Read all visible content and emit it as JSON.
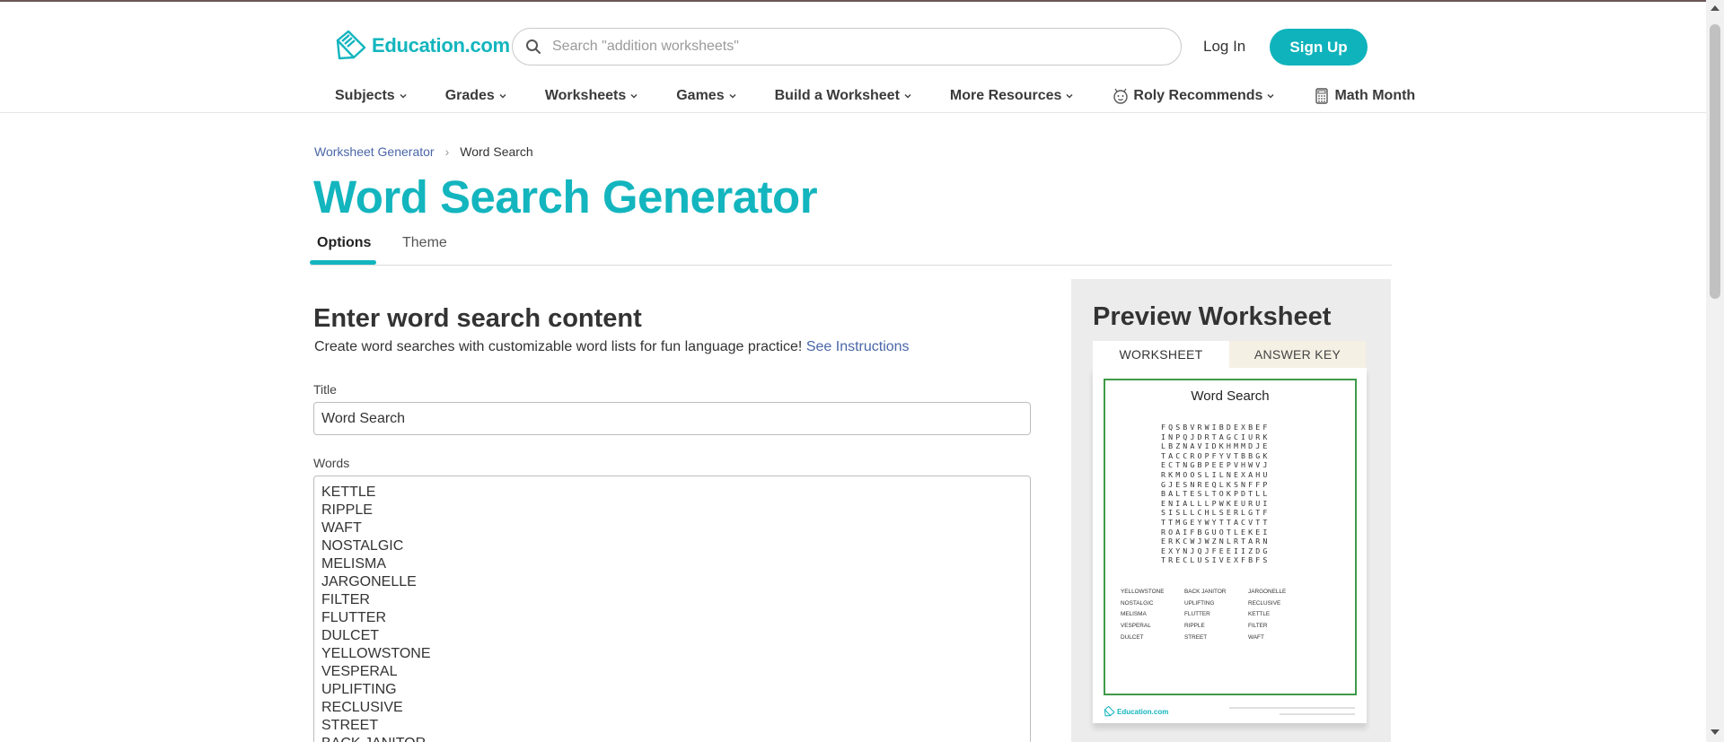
{
  "header": {
    "logo_text": "Education.com",
    "search_placeholder": "Search \"addition worksheets\"",
    "login_label": "Log In",
    "signup_label": "Sign Up",
    "brand_color": "#13b5be"
  },
  "nav": {
    "items": [
      {
        "label": "Subjects"
      },
      {
        "label": "Grades"
      },
      {
        "label": "Worksheets"
      },
      {
        "label": "Games"
      },
      {
        "label": "Build a Worksheet"
      },
      {
        "label": "More Resources"
      },
      {
        "label": "Roly Recommends",
        "icon": "roly-icon"
      },
      {
        "label": "Math Month",
        "icon": "calculator-icon"
      }
    ]
  },
  "breadcrumb": {
    "parent": "Worksheet Generator",
    "current": "Word Search"
  },
  "page": {
    "title": "Word Search Generator"
  },
  "tabs": {
    "options": "Options",
    "theme": "Theme",
    "active": "Options"
  },
  "form": {
    "section_title": "Enter word search content",
    "description": "Create word searches with customizable word lists for fun language practice!",
    "instructions_link": "See Instructions",
    "title_label": "Title",
    "title_value": "Word Search",
    "words_label": "Words",
    "words": [
      "KETTLE",
      "RIPPLE",
      "WAFT",
      "NOSTALGIC",
      "MELISMA",
      "JARGONELLE",
      "FILTER",
      "FLUTTER",
      "DULCET",
      "YELLOWSTONE",
      "VESPERAL",
      "UPLIFTING",
      "RECLUSIVE",
      "STREET",
      "BACK JANITOR"
    ]
  },
  "preview": {
    "title": "Preview Worksheet",
    "tab_worksheet": "WORKSHEET",
    "tab_answer_key": "ANSWER KEY",
    "sheet_title": "Word Search",
    "grid_rows": [
      "FQSBVRWIBDEXBEF",
      "INPQJDRTAGCIURK",
      "LBZNAVIDKHMMDJE",
      "TACCROPFYVTBBGK",
      "ECTNGBPEEPVHWVJ",
      "RKMOOSLILNEXAHU",
      "GJESNREQLKSNFFP",
      "BALTESLTOKPDTLL",
      "ENIALLLPWKEURUI",
      "SISLLCHLSERLGTF",
      "TTMGEYWYTTACVTT",
      "ROAIFBGUOTLEKEI",
      "ERKCWJWZNLRTARN",
      "EXYNJQJFEEIIZDG",
      "TRECLUSIVEXFBFS"
    ],
    "wordlist_columns": [
      [
        "YELLOWSTONE",
        "NOSTALGIC",
        "MELISMA",
        "VESPERAL",
        "DULCET"
      ],
      [
        "BACK JANITOR",
        "UPLIFTING",
        "FLUTTER",
        "RIPPLE",
        "STREET"
      ],
      [
        "JARGONELLE",
        "RECLUSIVE",
        "KETTLE",
        "FILTER",
        "WAFT"
      ]
    ],
    "footer_logo": "Education.com"
  }
}
